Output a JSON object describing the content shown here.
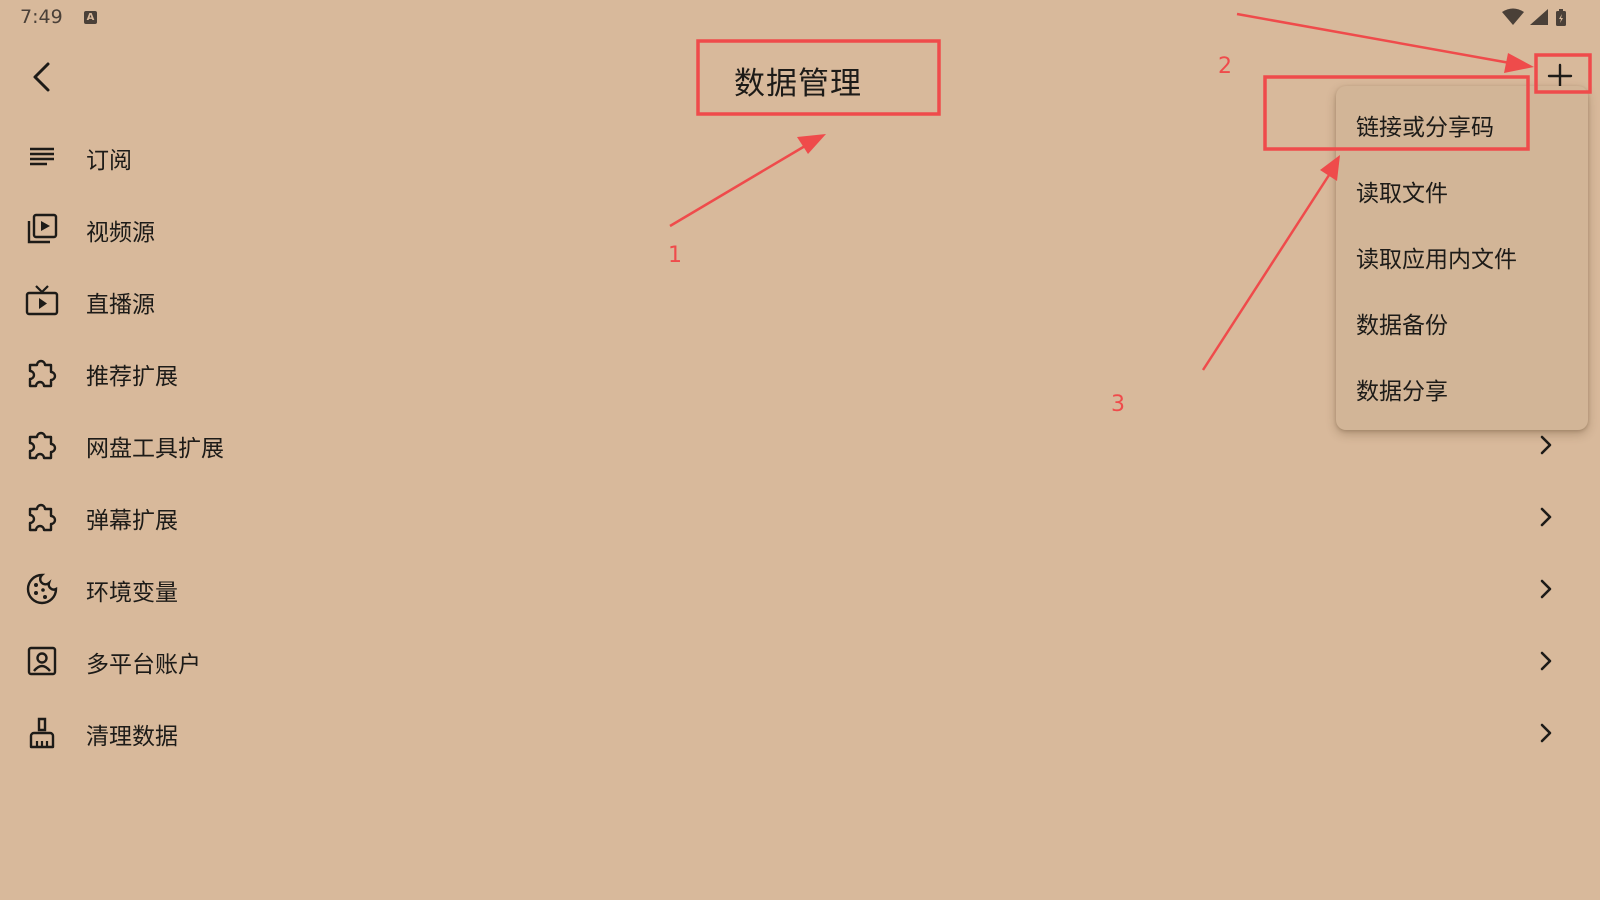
{
  "status_bar": {
    "time": "7:49",
    "badge": "A",
    "icons": [
      "wifi-icon",
      "signal-icon",
      "battery-icon"
    ]
  },
  "header": {
    "back_icon": "back-arrow-icon",
    "title": "数据管理",
    "add_icon": "plus-icon"
  },
  "list": [
    {
      "label": "订阅",
      "icon": "list-lines-icon"
    },
    {
      "label": "视频源",
      "icon": "video-library-icon"
    },
    {
      "label": "直播源",
      "icon": "live-tv-icon"
    },
    {
      "label": "推荐扩展",
      "icon": "puzzle-icon"
    },
    {
      "label": "网盘工具扩展",
      "icon": "puzzle-icon"
    },
    {
      "label": "弹幕扩展",
      "icon": "puzzle-icon"
    },
    {
      "label": "环境变量",
      "icon": "cookie-icon"
    },
    {
      "label": "多平台账户",
      "icon": "account-box-icon"
    },
    {
      "label": "清理数据",
      "icon": "broom-icon"
    }
  ],
  "dropdown_menu": [
    {
      "label": "链接或分享码"
    },
    {
      "label": "读取文件"
    },
    {
      "label": "读取应用内文件"
    },
    {
      "label": "数据备份"
    },
    {
      "label": "数据分享"
    }
  ],
  "annotations": {
    "labels": [
      "1",
      "2",
      "3"
    ],
    "color": "#ef4b4b"
  },
  "colors": {
    "background": "#d8b99b",
    "menu_background": "#d2b597",
    "text": "#1d1b18",
    "annotation": "#ef4b4b"
  }
}
